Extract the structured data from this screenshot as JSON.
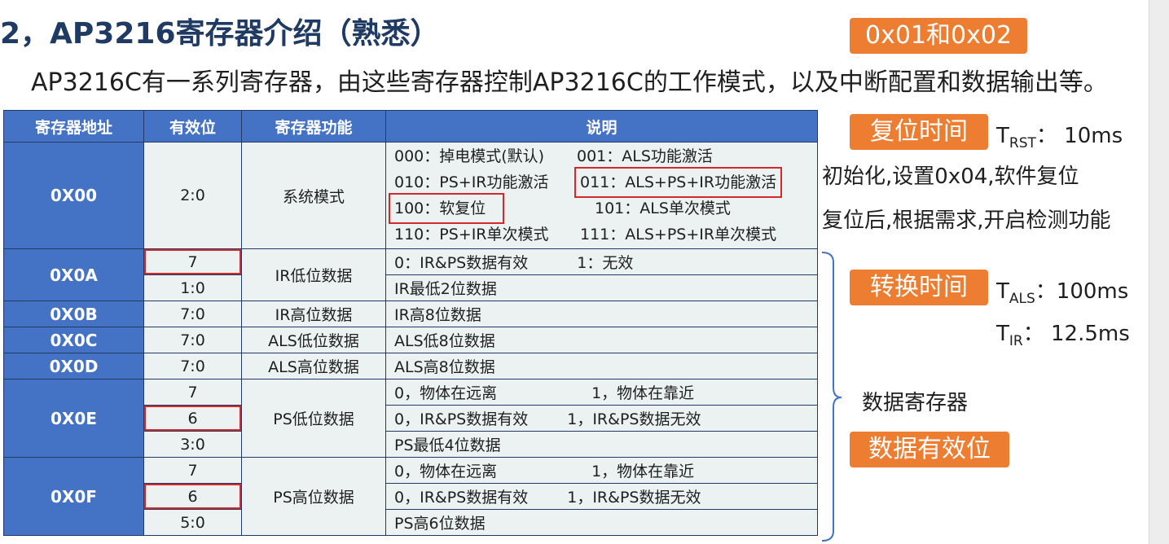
{
  "title": "2，AP3216寄存器介绍（熟悉）",
  "subtitle": "AP3216C有一系列寄存器，由这些寄存器控制AP3216C的工作模式，以及中断配置和数据输出等。",
  "table": {
    "headers": [
      "寄存器地址",
      "有效位",
      "寄存器功能",
      "说明"
    ],
    "r00": {
      "addr": "0X00",
      "bits": "2:0",
      "func": "系统模式",
      "l1a": "000：掉电模式(默认)",
      "l1b": "001：ALS功能激活",
      "l2a": "010：PS+IR功能激活",
      "l2b": "011：ALS+PS+IR功能激活",
      "l3a": "100：软复位",
      "l3b": "101：ALS单次模式",
      "l4a": "110：PS+IR单次模式",
      "l4b": "111：ALS+PS+IR单次模式"
    },
    "r0a": {
      "addr": "0X0A",
      "func": "IR低位数据",
      "bits1": "7",
      "desc1a": "0：IR&PS数据有效",
      "desc1b": "1：无效",
      "bits2": "1:0",
      "desc2": "IR最低2位数据"
    },
    "r0b": {
      "addr": "0X0B",
      "bits": "7:0",
      "func": "IR高位数据",
      "desc": "IR高8位数据"
    },
    "r0c": {
      "addr": "0X0C",
      "bits": "7:0",
      "func": "ALS低位数据",
      "desc": "ALS低8位数据"
    },
    "r0d": {
      "addr": "0X0D",
      "bits": "7:0",
      "func": "ALS高位数据",
      "desc": "ALS高8位数据"
    },
    "r0e": {
      "addr": "0X0E",
      "func": "PS低位数据",
      "bits1": "7",
      "desc1a": "0，物体在远离",
      "desc1b": "1，物体在靠近",
      "bits2": "6",
      "desc2a": "0，IR&PS数据有效",
      "desc2b": "1，IR&PS数据无效",
      "bits3": "3:0",
      "desc3": "PS最低4位数据"
    },
    "r0f": {
      "addr": "0X0F",
      "func": "PS高位数据",
      "bits1": "7",
      "desc1a": "0，物体在远离",
      "desc1b": "1，物体在靠近",
      "bits2": "6",
      "desc2a": "0，IR&PS数据有效",
      "desc2b": "1，IR&PS数据无效",
      "bits3": "5:0",
      "desc3": "PS高6位数据"
    }
  },
  "side": {
    "badge_regs": "0x01和0x02",
    "badge_reset": "复位时间",
    "trst_main": "T",
    "trst_sub": "RST",
    "trst_value": "：  10ms",
    "init_text": "初始化,设置0x04,软件复位",
    "after_reset_text": "复位后,根据需求,开启检测功能",
    "badge_convert": "转换时间",
    "tals_main": "T",
    "tals_sub": "ALS",
    "tals_value": "：100ms",
    "tir_main": "T",
    "tir_sub": "IR",
    "tir_value": "：    12.5ms",
    "data_regs_label": "数据寄存器",
    "badge_valid_bits": "数据有效位"
  },
  "colors": {
    "header_blue": "#4472c4",
    "cell_bg": "#ecf2f1",
    "badge_orange": "#ed7d31",
    "highlight_red": "#d62828",
    "title_navy": "#1f3a63"
  }
}
